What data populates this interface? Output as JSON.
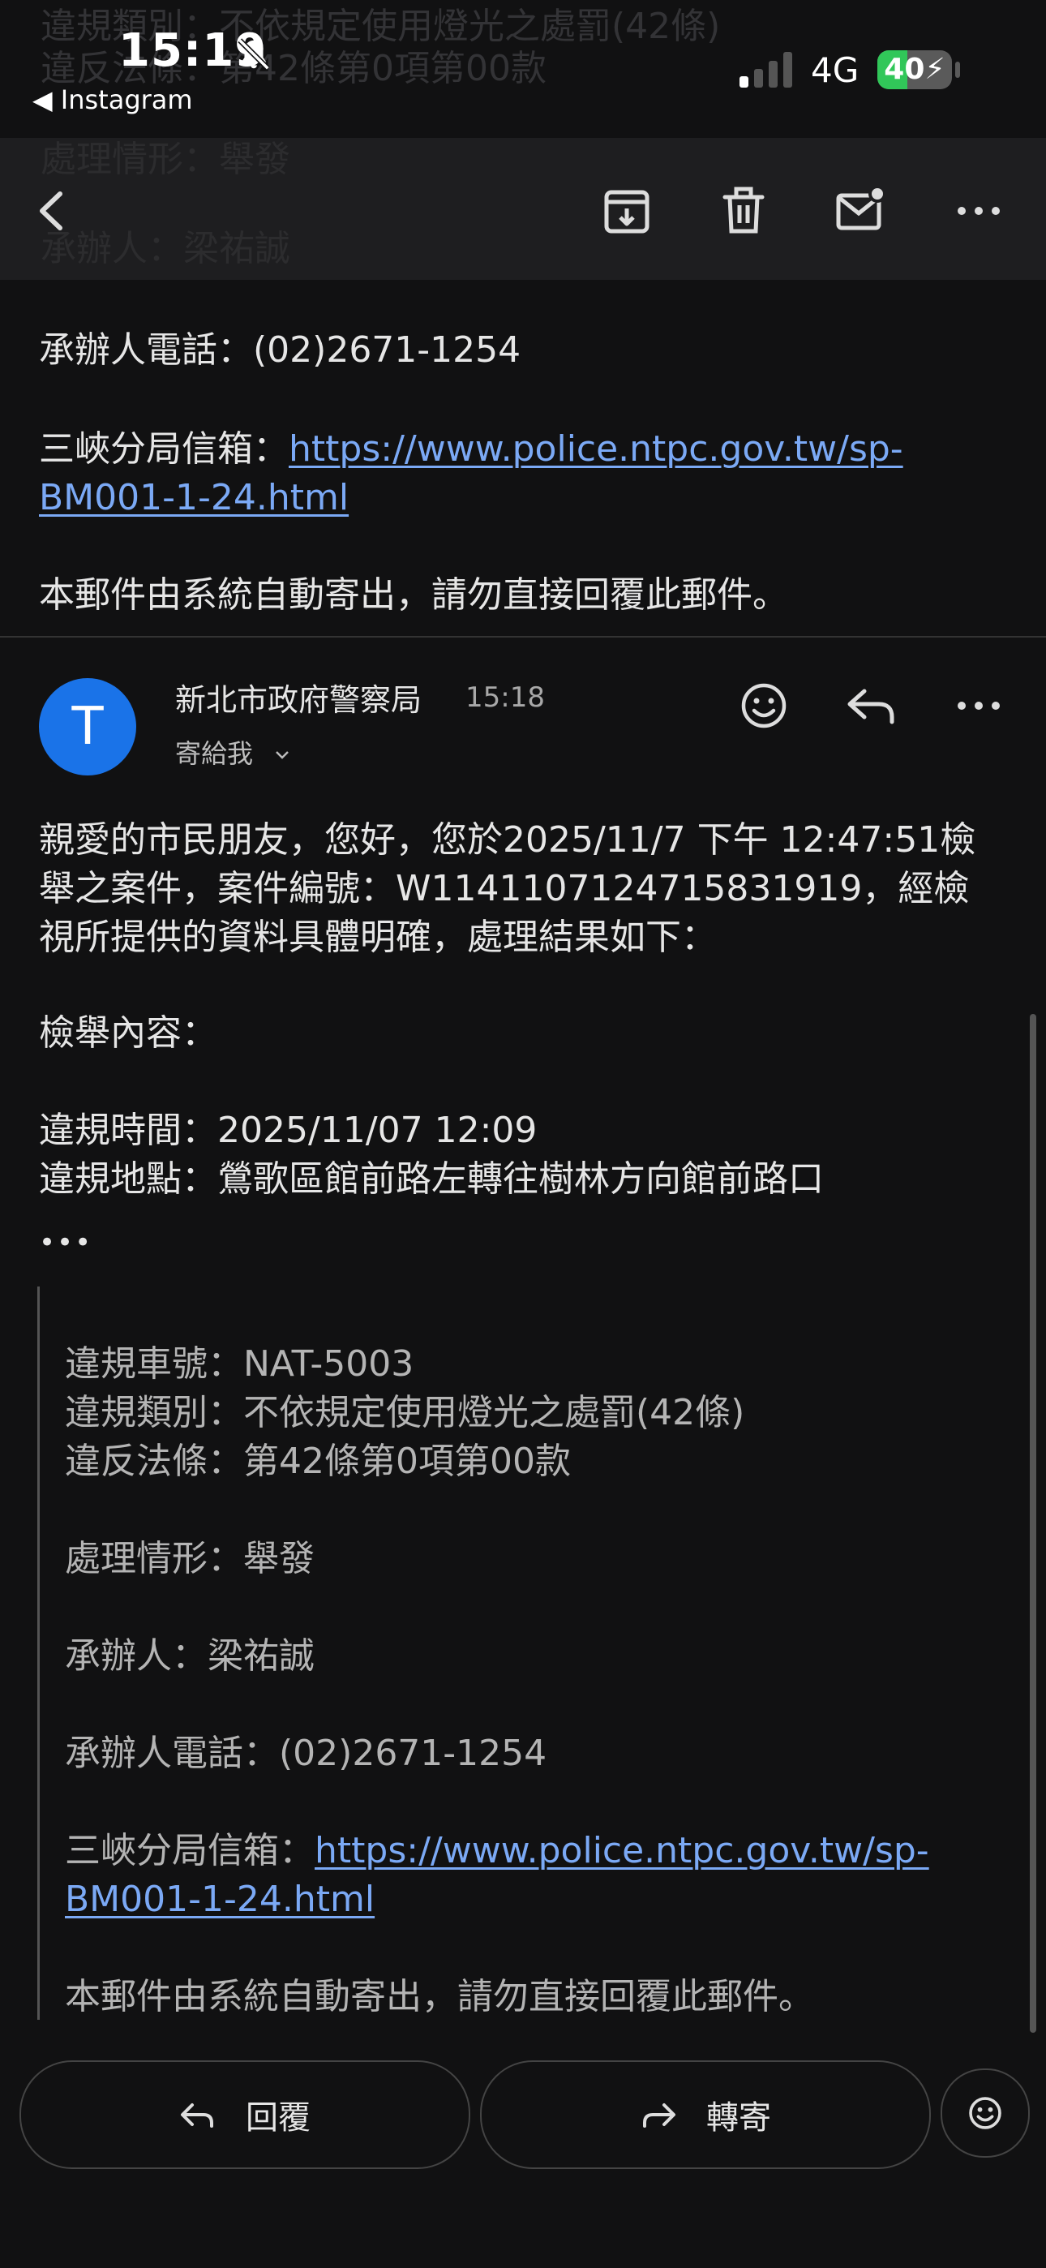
{
  "status_bar": {
    "time": "15:19",
    "back_app": "◀ Instagram",
    "network": "4G",
    "battery": "40",
    "battery_level": 0.4
  },
  "ghost_text": {
    "line1": "違規類別：不依規定使用燈光之處罰(42條)",
    "line2": "違反法條：第42條第0項第00款",
    "line3": "處理情形：舉發",
    "line4": "承辦人：梁祐誠"
  },
  "prev_message": {
    "phone": "承辦人電話：(02)2671-1254",
    "mailbox_label": "三峽分局信箱：",
    "mailbox_link_1": "https://www.police.ntpc.gov.tw/sp-",
    "mailbox_link_2": "BM001-1-24.html",
    "auto_notice": "本郵件由系統自動寄出，請勿直接回覆此郵件。"
  },
  "message": {
    "avatar_letter": "T",
    "sender": "新北市政府警察局",
    "time": "15:18",
    "recipient": "寄給我",
    "body_line1": "親愛的市民朋友，您好，您於2025/11/7 下午 12:47:51檢",
    "body_line2": "舉之案件，案件編號：W1141107124715831919，經檢",
    "body_line3": "視所提供的資料具體明確，處理結果如下：",
    "content_label": "檢舉內容：",
    "violation_time": "違規時間：2025/11/07 12:09",
    "violation_place": "違規地點：鶯歌區館前路左轉往樹林方向館前路口",
    "more": "•••"
  },
  "quoted": {
    "plate": "違規車號：NAT-5003",
    "category": "違規類別：不依規定使用燈光之處罰(42條)",
    "law": "違反法條：第42條第0項第00款",
    "status": "處理情形：舉發",
    "officer": "承辦人：梁祐誠",
    "phone": "承辦人電話：(02)2671-1254",
    "mailbox_label": "三峽分局信箱：",
    "mailbox_link_1": "https://www.police.ntpc.gov.tw/sp-",
    "mailbox_link_2": "BM001-1-24.html",
    "auto_notice": "本郵件由系統自動寄出，請勿直接回覆此郵件。"
  },
  "actions": {
    "reply": "回覆",
    "forward": "轉寄"
  },
  "icons": {
    "toolbar": [
      "back-arrow-icon",
      "archive-icon",
      "trash-icon",
      "mark-unread-icon",
      "more-icon"
    ],
    "message": [
      "emoji-icon",
      "reply-icon",
      "more-icon"
    ]
  }
}
